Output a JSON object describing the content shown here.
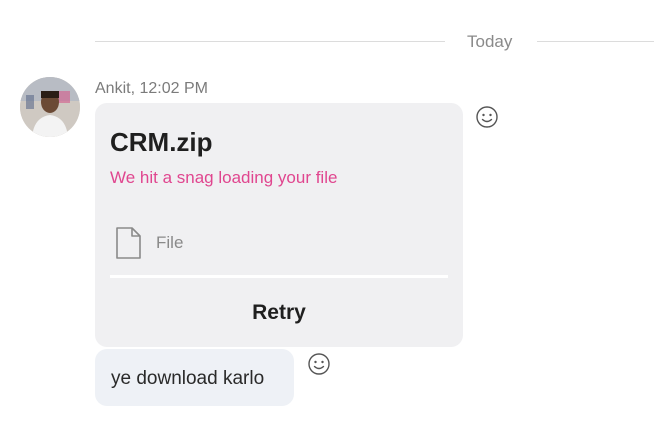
{
  "divider": {
    "label": "Today"
  },
  "message": {
    "sender": "Ankit",
    "time": "12:02 PM",
    "meta": "Ankit, 12:02 PM",
    "avatar_icon": "user-photo"
  },
  "file_card": {
    "file_name": "CRM.zip",
    "error_text": "We hit a snag loading your file",
    "file_type": "File",
    "file_icon": "document-icon",
    "retry_label": "Retry",
    "error_color": "#e0468f"
  },
  "text_message": {
    "text": "ye download karlo"
  },
  "icons": {
    "react": "smiley-icon"
  }
}
